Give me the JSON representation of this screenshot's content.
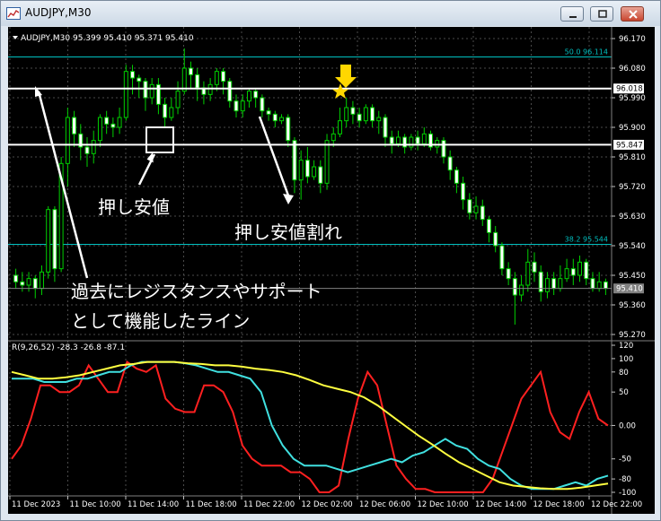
{
  "window": {
    "title": "AUDJPY,M30"
  },
  "chart_data": [
    {
      "type": "candlestick",
      "header": "AUDJPY,M30  95.399 95.410 95.371 95.410",
      "ylim": [
        95.27,
        96.17
      ],
      "y_ticks": [
        "96.170",
        "96.080",
        "95.990",
        "95.900",
        "95.810",
        "95.720",
        "95.630",
        "95.540",
        "95.450",
        "95.360",
        "95.270"
      ],
      "x_labels": [
        "11 Dec 2023",
        "11 Dec 10:00",
        "11 Dec 14:00",
        "11 Dec 18:00",
        "11 Dec 22:00",
        "12 Dec 02:00",
        "12 Dec 06:00",
        "12 Dec 10:00",
        "12 Dec 14:00",
        "12 Dec 18:00",
        "12 Dec 22:00"
      ],
      "candles": [
        [
          95.45,
          95.43,
          95.47,
          95.41
        ],
        [
          95.43,
          95.42,
          95.46,
          95.4
        ],
        [
          95.42,
          95.44,
          95.46,
          95.4
        ],
        [
          95.44,
          95.41,
          95.45,
          95.38
        ],
        [
          95.41,
          95.46,
          95.48,
          95.39
        ],
        [
          95.46,
          95.65,
          95.66,
          95.44
        ],
        [
          95.65,
          95.47,
          95.66,
          95.43
        ],
        [
          95.47,
          95.79,
          95.81,
          95.46
        ],
        [
          95.79,
          95.93,
          95.96,
          95.72
        ],
        [
          95.93,
          95.88,
          95.95,
          95.84
        ],
        [
          95.88,
          95.84,
          95.91,
          95.8
        ],
        [
          95.84,
          95.82,
          95.87,
          95.78
        ],
        [
          95.82,
          95.86,
          95.89,
          95.79
        ],
        [
          95.86,
          95.93,
          95.94,
          95.84
        ],
        [
          95.93,
          95.91,
          95.95,
          95.88
        ],
        [
          95.91,
          95.9,
          95.93,
          95.87
        ],
        [
          95.9,
          95.93,
          95.96,
          95.88
        ],
        [
          95.93,
          96.07,
          96.09,
          95.92
        ],
        [
          96.07,
          96.05,
          96.09,
          96.0
        ],
        [
          96.05,
          96.04,
          96.06,
          95.99
        ],
        [
          96.04,
          95.99,
          96.05,
          95.95
        ],
        [
          95.99,
          96.03,
          96.05,
          95.97
        ],
        [
          96.03,
          95.97,
          96.05,
          95.94
        ],
        [
          95.97,
          95.93,
          95.99,
          95.9
        ],
        [
          95.93,
          95.96,
          95.99,
          95.92
        ],
        [
          95.96,
          96.01,
          96.04,
          95.94
        ],
        [
          96.01,
          96.08,
          96.14,
          96.0
        ],
        [
          96.08,
          96.06,
          96.1,
          96.02
        ],
        [
          96.06,
          96.02,
          96.08,
          95.98
        ],
        [
          96.02,
          96.0,
          96.04,
          95.97
        ],
        [
          96.0,
          96.03,
          96.05,
          95.98
        ],
        [
          96.03,
          96.07,
          96.08,
          96.01
        ],
        [
          96.07,
          96.04,
          96.08,
          96.0
        ],
        [
          96.04,
          95.98,
          96.05,
          95.96
        ],
        [
          95.98,
          95.95,
          96.0,
          95.93
        ],
        [
          95.95,
          95.98,
          96.0,
          95.93
        ],
        [
          95.98,
          96.01,
          96.02,
          95.96
        ],
        [
          96.01,
          95.99,
          96.02,
          95.96
        ],
        [
          95.99,
          95.95,
          96.0,
          95.93
        ],
        [
          95.95,
          95.94,
          95.96,
          95.92
        ],
        [
          95.94,
          95.92,
          95.95,
          95.9
        ],
        [
          95.92,
          95.93,
          95.94,
          95.91
        ],
        [
          95.93,
          95.86,
          95.94,
          95.84
        ],
        [
          95.86,
          95.74,
          95.87,
          95.7
        ],
        [
          95.74,
          95.8,
          95.83,
          95.68
        ],
        [
          95.8,
          95.75,
          95.84,
          95.73
        ],
        [
          95.75,
          95.78,
          95.8,
          95.74
        ],
        [
          95.78,
          95.73,
          95.8,
          95.7
        ],
        [
          95.73,
          95.86,
          95.88,
          95.71
        ],
        [
          95.86,
          95.88,
          95.9,
          95.84
        ],
        [
          95.88,
          95.92,
          95.96,
          95.87
        ],
        [
          95.92,
          95.96,
          95.99,
          95.9
        ],
        [
          95.96,
          95.94,
          95.98,
          95.91
        ],
        [
          95.94,
          95.92,
          95.96,
          95.9
        ],
        [
          95.92,
          95.96,
          95.97,
          95.91
        ],
        [
          95.96,
          95.92,
          95.97,
          95.9
        ],
        [
          95.92,
          95.93,
          95.95,
          95.88
        ],
        [
          95.93,
          95.87,
          95.94,
          95.84
        ],
        [
          95.87,
          95.85,
          95.89,
          95.82
        ],
        [
          95.85,
          95.87,
          95.89,
          95.84
        ],
        [
          95.87,
          95.84,
          95.88,
          95.82
        ],
        [
          95.84,
          95.87,
          95.88,
          95.83
        ],
        [
          95.87,
          95.85,
          95.89,
          95.83
        ],
        [
          95.85,
          95.88,
          95.9,
          95.84
        ],
        [
          95.88,
          95.84,
          95.89,
          95.83
        ],
        [
          95.84,
          95.86,
          95.87,
          95.82
        ],
        [
          95.86,
          95.81,
          95.87,
          95.79
        ],
        [
          95.81,
          95.77,
          95.83,
          95.74
        ],
        [
          95.77,
          95.73,
          95.78,
          95.7
        ],
        [
          95.73,
          95.68,
          95.75,
          95.65
        ],
        [
          95.68,
          95.64,
          95.7,
          95.62
        ],
        [
          95.64,
          95.66,
          95.69,
          95.62
        ],
        [
          95.66,
          95.62,
          95.68,
          95.6
        ],
        [
          95.62,
          95.58,
          95.63,
          95.55
        ],
        [
          95.58,
          95.54,
          95.6,
          95.52
        ],
        [
          95.54,
          95.47,
          95.55,
          95.45
        ],
        [
          95.47,
          95.44,
          95.49,
          95.42
        ],
        [
          95.44,
          95.39,
          95.46,
          95.3
        ],
        [
          95.39,
          95.42,
          95.45,
          95.37
        ],
        [
          95.42,
          95.49,
          95.53,
          95.4
        ],
        [
          95.49,
          95.46,
          95.52,
          95.43
        ],
        [
          95.46,
          95.4,
          95.48,
          95.37
        ],
        [
          95.4,
          95.44,
          95.46,
          95.38
        ],
        [
          95.44,
          95.41,
          95.46,
          95.39
        ],
        [
          95.41,
          95.44,
          95.48,
          95.4
        ],
        [
          95.44,
          95.47,
          95.5,
          95.43
        ],
        [
          95.47,
          95.45,
          95.5,
          95.42
        ],
        [
          95.45,
          95.49,
          95.51,
          95.43
        ],
        [
          95.49,
          95.44,
          95.5,
          95.42
        ],
        [
          95.44,
          95.41,
          95.46,
          95.4
        ],
        [
          95.41,
          95.43,
          95.46,
          95.4
        ],
        [
          95.43,
          95.41,
          95.44,
          95.39
        ]
      ],
      "h_lines": [
        {
          "price": 96.018,
          "label": "96.018",
          "color": "#ffffff"
        },
        {
          "price": 95.847,
          "label": "95.847",
          "color": "#ffffff"
        },
        {
          "price": 95.41,
          "label": "95.410",
          "color": "#808080"
        }
      ],
      "fib_levels": [
        {
          "price": 96.114,
          "label": "50.0  96.114"
        },
        {
          "price": 95.544,
          "label": "38.2  95.544"
        }
      ],
      "annotations": [
        "押し安値",
        "押し安値割れ",
        "過去にレジスタンスやサポート",
        "として機能したライン"
      ],
      "colors": {
        "bull": "#00d000",
        "bear": "#ffffff",
        "wick": "#00d000",
        "grid": "#4a4a4a",
        "fib": "#00bfbf",
        "arrow": "#ffd700",
        "star": "#ffd700"
      }
    },
    {
      "type": "line",
      "header": "R(9,26,52)  -28.3  -26.8  -87.1",
      "ylim": [
        -100,
        120
      ],
      "y_ticks": [
        "120",
        "100",
        "80",
        "50",
        "0.00",
        "-50",
        "-80",
        "-100"
      ],
      "series": [
        {
          "color": "#ff2020",
          "values": [
            -50,
            -30,
            10,
            60,
            60,
            50,
            50,
            60,
            90,
            70,
            50,
            50,
            95,
            85,
            80,
            90,
            40,
            25,
            20,
            20,
            60,
            60,
            50,
            20,
            -30,
            -50,
            -60,
            -60,
            -60,
            -70,
            -70,
            -80,
            -100,
            -100,
            -90,
            -20,
            40,
            80,
            60,
            0,
            -60,
            -80,
            -95,
            -95,
            -100,
            -100,
            -100,
            -100,
            -100,
            -100,
            -80,
            -40,
            0,
            40,
            60,
            80,
            20,
            -10,
            -20,
            20,
            50,
            10,
            0
          ]
        },
        {
          "color": "#40e0e0",
          "values": [
            70,
            70,
            70,
            65,
            65,
            65,
            70,
            70,
            75,
            80,
            80,
            90,
            95,
            95,
            95,
            95,
            93,
            90,
            85,
            80,
            80,
            75,
            70,
            50,
            0,
            -30,
            -50,
            -60,
            -60,
            -60,
            -65,
            -70,
            -65,
            -60,
            -55,
            -50,
            -55,
            -45,
            -40,
            -30,
            -20,
            -30,
            -35,
            -50,
            -60,
            -65,
            -80,
            -90,
            -95,
            -95,
            -95,
            -90,
            -85,
            -90,
            -80,
            -75
          ]
        },
        {
          "color": "#ffff40",
          "values": [
            80,
            75,
            70,
            70,
            72,
            75,
            80,
            85,
            90,
            92,
            95,
            95,
            95,
            93,
            92,
            90,
            90,
            88,
            85,
            83,
            80,
            75,
            68,
            60,
            55,
            50,
            42,
            30,
            15,
            0,
            -15,
            -28,
            -42,
            -55,
            -65,
            -75,
            -85,
            -90,
            -92,
            -94,
            -95,
            -95,
            -93,
            -90,
            -87
          ]
        }
      ]
    }
  ]
}
